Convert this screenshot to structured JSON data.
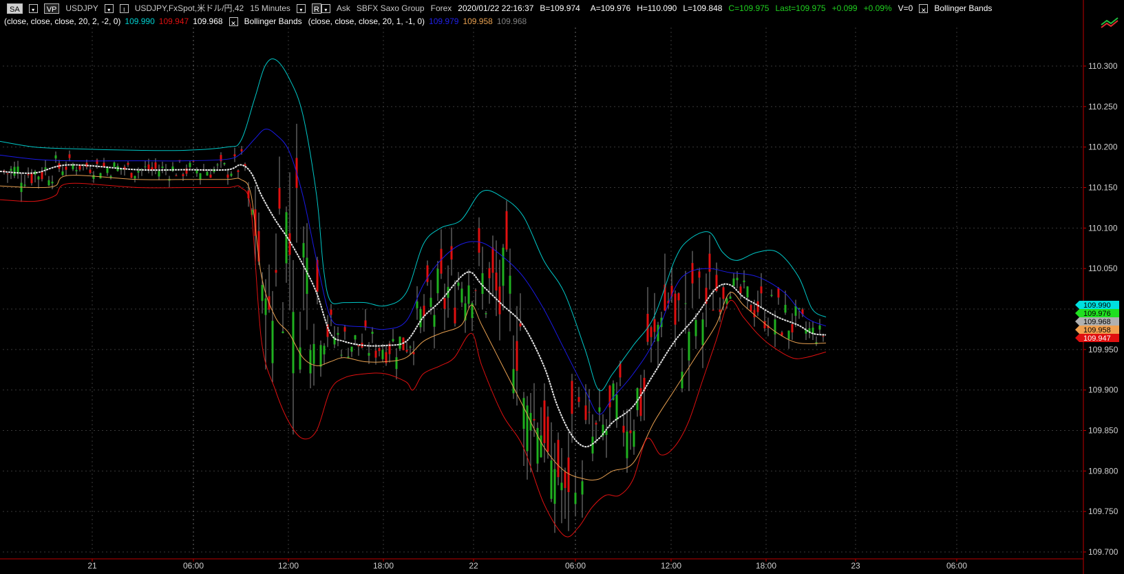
{
  "toolbar": {
    "sa_button": "SA",
    "vp_button": "VP",
    "symbol": "USDJPY",
    "instrument": "USDJPY,FxSpot,米ドル/円,42",
    "timeframe": "15 Minutes",
    "price_side": "Ask",
    "source": "SBFX Saxo Group",
    "asset_class": "Forex",
    "datetime": "2020/01/22 22:16:37",
    "bid": "B=109.974",
    "ask": "A=109.976",
    "high": "H=110.090",
    "low": "L=109.848",
    "close": "C=109.975",
    "last": "Last=109.975",
    "change": "+0.099",
    "change_pct": "+0.09%",
    "volume": "V=0",
    "indicator1_name": "Bollinger Bands",
    "r_button": "R"
  },
  "indicator_line": {
    "params1": "(close,  close,  close,  20,  2,  -2,  0)",
    "v1_upper": "109.990",
    "v1_lower": "109.947",
    "v1_mid": "109.968",
    "indicator2_name": "Bollinger Bands",
    "params2": "(close,  close,  close,  20,  1,  -1,  0)",
    "v2_upper": "109.979",
    "v2_lower": "109.958",
    "v2_mid": "109.968"
  },
  "colors": {
    "bb2_upper": "#00c8c8",
    "bb2_lower": "#e01010",
    "bb1_upper": "#1a1ae8",
    "bb1_lower": "#e8a050",
    "middle": "#e8e8e8",
    "candle_up": "#20b020",
    "candle_down": "#e01010",
    "axis": "#c00000",
    "positive": "#20d020",
    "grid": "#3a3a3a"
  },
  "price_axis": {
    "labels": [
      "110.300",
      "110.250",
      "110.200",
      "110.150",
      "110.100",
      "110.050",
      "110.000",
      "109.950",
      "109.900",
      "109.850",
      "109.800",
      "109.750",
      "109.700"
    ]
  },
  "price_tags": [
    {
      "value": "109.990",
      "bg": "#00e0e0",
      "fg": "#000000"
    },
    {
      "value": "109.976",
      "bg": "#20e020",
      "fg": "#000000"
    },
    {
      "value": "109.968",
      "bg": "#b0b0b0",
      "fg": "#000000"
    },
    {
      "value": "109.958",
      "bg": "#f0a050",
      "fg": "#000000"
    },
    {
      "value": "109.947",
      "bg": "#e01010",
      "fg": "#ffffff"
    }
  ],
  "time_axis": {
    "labels": [
      "21",
      "06:00",
      "12:00",
      "18:00",
      "22",
      "06:00",
      "12:00",
      "18:00",
      "23",
      "06:00"
    ]
  },
  "chart_data": {
    "type": "candlestick",
    "ylim": [
      109.69,
      110.33
    ],
    "grid": true,
    "series_colors_note": "",
    "bands": {
      "upper2": [
        [
          0,
          110.207
        ],
        [
          50,
          110.2
        ],
        [
          100,
          110.198
        ],
        [
          200,
          110.196
        ],
        [
          270,
          110.196
        ],
        [
          330,
          110.2
        ],
        [
          350,
          110.208
        ],
        [
          370,
          110.26
        ],
        [
          385,
          110.3
        ],
        [
          400,
          110.308
        ],
        [
          420,
          110.285
        ],
        [
          440,
          110.24
        ],
        [
          460,
          110.14
        ],
        [
          470,
          110.05
        ],
        [
          480,
          110.01
        ],
        [
          500,
          110.008
        ],
        [
          530,
          110.008
        ],
        [
          560,
          110.004
        ],
        [
          590,
          110.02
        ],
        [
          615,
          110.08
        ],
        [
          640,
          110.1
        ],
        [
          670,
          110.11
        ],
        [
          700,
          110.145
        ],
        [
          730,
          110.138
        ],
        [
          760,
          110.115
        ],
        [
          790,
          110.06
        ],
        [
          820,
          110.02
        ],
        [
          850,
          109.95
        ],
        [
          870,
          109.9
        ],
        [
          890,
          109.92
        ],
        [
          920,
          109.955
        ],
        [
          950,
          109.99
        ],
        [
          980,
          110.06
        ],
        [
          1000,
          110.085
        ],
        [
          1030,
          110.095
        ],
        [
          1050,
          110.07
        ],
        [
          1070,
          110.06
        ],
        [
          1100,
          110.07
        ],
        [
          1130,
          110.07
        ],
        [
          1160,
          110.04
        ],
        [
          1180,
          110.0
        ],
        [
          1200,
          109.99
        ]
      ],
      "upper1": [
        [
          0,
          110.19
        ],
        [
          50,
          110.185
        ],
        [
          100,
          110.183
        ],
        [
          200,
          110.183
        ],
        [
          270,
          110.183
        ],
        [
          330,
          110.185
        ],
        [
          350,
          110.192
        ],
        [
          370,
          110.21
        ],
        [
          385,
          110.222
        ],
        [
          400,
          110.216
        ],
        [
          420,
          110.195
        ],
        [
          440,
          110.14
        ],
        [
          460,
          110.06
        ],
        [
          480,
          109.99
        ],
        [
          500,
          109.98
        ],
        [
          530,
          109.978
        ],
        [
          560,
          109.975
        ],
        [
          590,
          109.985
        ],
        [
          615,
          110.03
        ],
        [
          640,
          110.06
        ],
        [
          670,
          110.08
        ],
        [
          700,
          110.082
        ],
        [
          730,
          110.065
        ],
        [
          760,
          110.04
        ],
        [
          790,
          110.0
        ],
        [
          820,
          109.95
        ],
        [
          850,
          109.9
        ],
        [
          870,
          109.87
        ],
        [
          890,
          109.89
        ],
        [
          920,
          109.92
        ],
        [
          950,
          109.96
        ],
        [
          980,
          110.025
        ],
        [
          1000,
          110.045
        ],
        [
          1030,
          110.05
        ],
        [
          1060,
          110.045
        ],
        [
          1100,
          110.04
        ],
        [
          1140,
          110.02
        ],
        [
          1170,
          109.99
        ],
        [
          1200,
          109.979
        ]
      ],
      "middle": [
        [
          0,
          110.17
        ],
        [
          50,
          110.168
        ],
        [
          100,
          110.178
        ],
        [
          200,
          110.172
        ],
        [
          270,
          110.172
        ],
        [
          330,
          110.172
        ],
        [
          350,
          110.178
        ],
        [
          365,
          110.168
        ],
        [
          380,
          110.14
        ],
        [
          400,
          110.11
        ],
        [
          420,
          110.085
        ],
        [
          440,
          110.055
        ],
        [
          460,
          110.02
        ],
        [
          480,
          109.97
        ],
        [
          500,
          109.96
        ],
        [
          530,
          109.955
        ],
        [
          560,
          109.955
        ],
        [
          590,
          109.96
        ],
        [
          615,
          109.99
        ],
        [
          640,
          110.01
        ],
        [
          670,
          110.04
        ],
        [
          685,
          110.045
        ],
        [
          700,
          110.03
        ],
        [
          730,
          110.005
        ],
        [
          760,
          109.98
        ],
        [
          790,
          109.93
        ],
        [
          810,
          109.88
        ],
        [
          830,
          109.845
        ],
        [
          850,
          109.83
        ],
        [
          870,
          109.84
        ],
        [
          890,
          109.86
        ],
        [
          920,
          109.88
        ],
        [
          950,
          109.92
        ],
        [
          980,
          109.96
        ],
        [
          1010,
          109.99
        ],
        [
          1040,
          110.025
        ],
        [
          1060,
          110.03
        ],
        [
          1080,
          110.015
        ],
        [
          1100,
          110.005
        ],
        [
          1130,
          109.99
        ],
        [
          1160,
          109.98
        ],
        [
          1180,
          109.97
        ],
        [
          1200,
          109.968
        ]
      ],
      "lower1": [
        [
          0,
          110.152
        ],
        [
          50,
          110.15
        ],
        [
          80,
          110.152
        ],
        [
          100,
          110.165
        ],
        [
          200,
          110.16
        ],
        [
          270,
          110.16
        ],
        [
          330,
          110.16
        ],
        [
          350,
          110.16
        ],
        [
          365,
          110.14
        ],
        [
          380,
          110.04
        ],
        [
          400,
          109.99
        ],
        [
          420,
          109.97
        ],
        [
          440,
          109.94
        ],
        [
          460,
          109.93
        ],
        [
          480,
          109.935
        ],
        [
          500,
          109.94
        ],
        [
          530,
          109.935
        ],
        [
          560,
          109.935
        ],
        [
          590,
          109.94
        ],
        [
          615,
          109.96
        ],
        [
          640,
          109.97
        ],
        [
          670,
          109.98
        ],
        [
          685,
          110.005
        ],
        [
          700,
          109.98
        ],
        [
          730,
          109.93
        ],
        [
          760,
          109.88
        ],
        [
          790,
          109.83
        ],
        [
          820,
          109.8
        ],
        [
          850,
          109.79
        ],
        [
          870,
          109.79
        ],
        [
          890,
          109.8
        ],
        [
          920,
          109.81
        ],
        [
          950,
          109.86
        ],
        [
          980,
          109.9
        ],
        [
          1010,
          109.94
        ],
        [
          1040,
          109.98
        ],
        [
          1060,
          110.02
        ],
        [
          1080,
          110.005
        ],
        [
          1100,
          109.99
        ],
        [
          1130,
          109.97
        ],
        [
          1160,
          109.958
        ],
        [
          1200,
          109.958
        ]
      ],
      "lower2": [
        [
          0,
          110.135
        ],
        [
          50,
          110.133
        ],
        [
          80,
          110.14
        ],
        [
          100,
          110.155
        ],
        [
          200,
          110.15
        ],
        [
          270,
          110.15
        ],
        [
          330,
          110.15
        ],
        [
          350,
          110.15
        ],
        [
          365,
          110.12
        ],
        [
          380,
          109.96
        ],
        [
          400,
          109.9
        ],
        [
          420,
          109.86
        ],
        [
          440,
          109.84
        ],
        [
          460,
          109.85
        ],
        [
          480,
          109.9
        ],
        [
          500,
          109.915
        ],
        [
          530,
          109.92
        ],
        [
          560,
          109.92
        ],
        [
          590,
          109.91
        ],
        [
          600,
          109.9
        ],
        [
          615,
          109.92
        ],
        [
          640,
          109.93
        ],
        [
          660,
          109.94
        ],
        [
          685,
          109.97
        ],
        [
          700,
          109.93
        ],
        [
          730,
          109.87
        ],
        [
          760,
          109.83
        ],
        [
          790,
          109.76
        ],
        [
          820,
          109.72
        ],
        [
          840,
          109.73
        ],
        [
          860,
          109.755
        ],
        [
          880,
          109.77
        ],
        [
          900,
          109.77
        ],
        [
          920,
          109.79
        ],
        [
          940,
          109.84
        ],
        [
          960,
          109.82
        ],
        [
          980,
          109.83
        ],
        [
          1000,
          109.86
        ],
        [
          1020,
          109.91
        ],
        [
          1040,
          109.96
        ],
        [
          1060,
          110.01
        ],
        [
          1080,
          109.99
        ],
        [
          1100,
          109.97
        ],
        [
          1120,
          109.955
        ],
        [
          1150,
          109.94
        ],
        [
          1170,
          109.94
        ],
        [
          1200,
          109.947
        ]
      ]
    }
  }
}
